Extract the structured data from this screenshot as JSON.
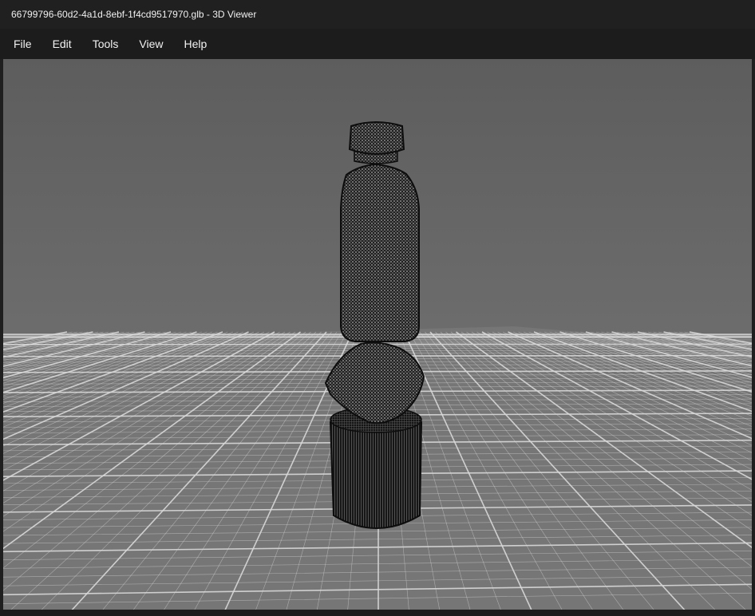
{
  "window": {
    "title": "66799796-60d2-4a1d-8ebf-1f4cd9517970.glb - 3D Viewer"
  },
  "menu": {
    "items": [
      {
        "label": "File"
      },
      {
        "label": "Edit"
      },
      {
        "label": "Tools"
      },
      {
        "label": "View"
      },
      {
        "label": "Help"
      }
    ]
  },
  "scene": {
    "background_top": "#5d5d5d",
    "background_bottom": "#7c7c7c",
    "grid_color": "#d9d9d9",
    "mesh_fill": "#1a1a1a",
    "mesh_wire": "#8a8a8a",
    "objects": [
      "bottle",
      "rounded-cube",
      "cylinder"
    ]
  }
}
